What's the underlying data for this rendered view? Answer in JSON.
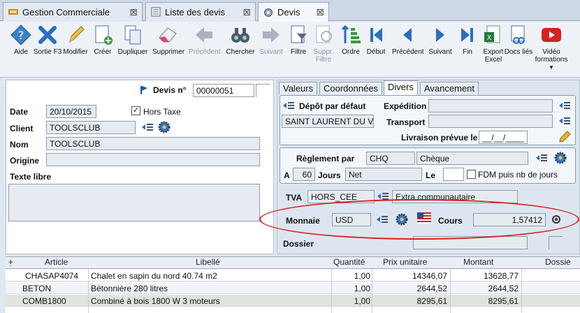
{
  "tabs": [
    {
      "label": "Gestion Commerciale",
      "icon": "sales-icon"
    },
    {
      "label": "Liste des devis",
      "icon": "list-icon"
    },
    {
      "label": "Devis",
      "icon": "quote-icon"
    }
  ],
  "toolbar": [
    {
      "label": "Aide",
      "icon": "help-icon",
      "enabled": true
    },
    {
      "label": "Sortie F3",
      "icon": "close-icon",
      "enabled": true
    },
    {
      "label": "Modifier",
      "icon": "pencil-icon",
      "enabled": true
    },
    {
      "label": "Créer",
      "icon": "new-document-icon",
      "enabled": true
    },
    {
      "label": "Dupliquer",
      "icon": "duplicate-icon",
      "enabled": true
    },
    {
      "label": "Supprimer",
      "icon": "eraser-icon",
      "enabled": true
    },
    {
      "label": "Précédent",
      "icon": "arrow-left-icon",
      "enabled": false
    },
    {
      "label": "Chercher",
      "icon": "binoculars-icon",
      "enabled": true
    },
    {
      "label": "Suivant",
      "icon": "arrow-right-icon",
      "enabled": false
    },
    {
      "label": "Filtre",
      "icon": "filter-icon",
      "enabled": true
    },
    {
      "label": "Suppr. Filtre",
      "icon": "remove-filter-icon",
      "enabled": false
    },
    {
      "label": "Ordre",
      "icon": "sort-icon",
      "enabled": true
    },
    {
      "label": "Début",
      "icon": "first-icon",
      "enabled": true
    },
    {
      "label": "Précédent",
      "icon": "previous-icon",
      "enabled": true
    },
    {
      "label": "Suivant",
      "icon": "next-icon",
      "enabled": true
    },
    {
      "label": "Fin",
      "icon": "last-icon",
      "enabled": true
    },
    {
      "label": "Export Excel",
      "icon": "excel-icon",
      "enabled": true
    },
    {
      "label": "Docs liés",
      "icon": "linked-docs-icon",
      "enabled": true
    },
    {
      "label": "Vidéo formations",
      "icon": "video-icon",
      "enabled": true
    }
  ],
  "form": {
    "devis_label": "Devis n°",
    "devis_no": "00000051",
    "date_label": "Date",
    "date": "20/10/2015",
    "hors_taxe": "Hors Taxe",
    "client_label": "Client",
    "client": "TOOLSCLUB",
    "nom_label": "Nom",
    "nom": "TOOLSCLUB",
    "origine_label": "Origine",
    "origine": "",
    "texte_libre_label": "Texte libre"
  },
  "right_tabs": [
    "Valeurs",
    "Coordonnées",
    "Divers",
    "Avancement"
  ],
  "divers": {
    "depot_label": "Dépôt par défaut",
    "depot_value": "SAINT LAURENT DU VA",
    "expedition_label": "Expédition",
    "transport_label": "Transport",
    "livraison_label": "Livraison prévue le",
    "livraison_value": "__/__/____",
    "reglement_label": "Règlement par",
    "reglement_code": "CHQ",
    "reglement_desc": "Chèque",
    "a_label": "A",
    "jours_value": "60",
    "jours_label": "Jours",
    "net_value": "Net",
    "le_label": "Le",
    "fdm_label": "FDM puis nb de jours",
    "tva_label": "TVA",
    "tva_code": "HORS_CEE",
    "tva_desc": "Extra communautaire",
    "monnaie_label": "Monnaie",
    "monnaie_value": "USD",
    "cours_label": "Cours",
    "cours_value": "1,57412",
    "dossier_label": "Dossier"
  },
  "grid": {
    "columns": [
      "Article",
      "Libellé",
      "Quantité",
      "Prix unitaire",
      "Montant",
      "Dossie"
    ],
    "rows": [
      {
        "article": "CHASAP4074",
        "libelle": "Chalet en sapin du nord 40.74 m2",
        "qte": "1,00",
        "pu": "14346,07",
        "montant": "13628,77"
      },
      {
        "article": "BETON",
        "libelle": "Bétonnière 280 litres",
        "qte": "1,00",
        "pu": "2644,52",
        "montant": "2644,52"
      },
      {
        "article": "COMB1800",
        "libelle": "Combiné à bois 1800 W 3 moteurs",
        "qte": "1,00",
        "pu": "8295,61",
        "montant": "8295,61"
      }
    ]
  },
  "colors": {
    "highlight_ellipse": "#d9201e",
    "accent": "#1a66c6"
  }
}
